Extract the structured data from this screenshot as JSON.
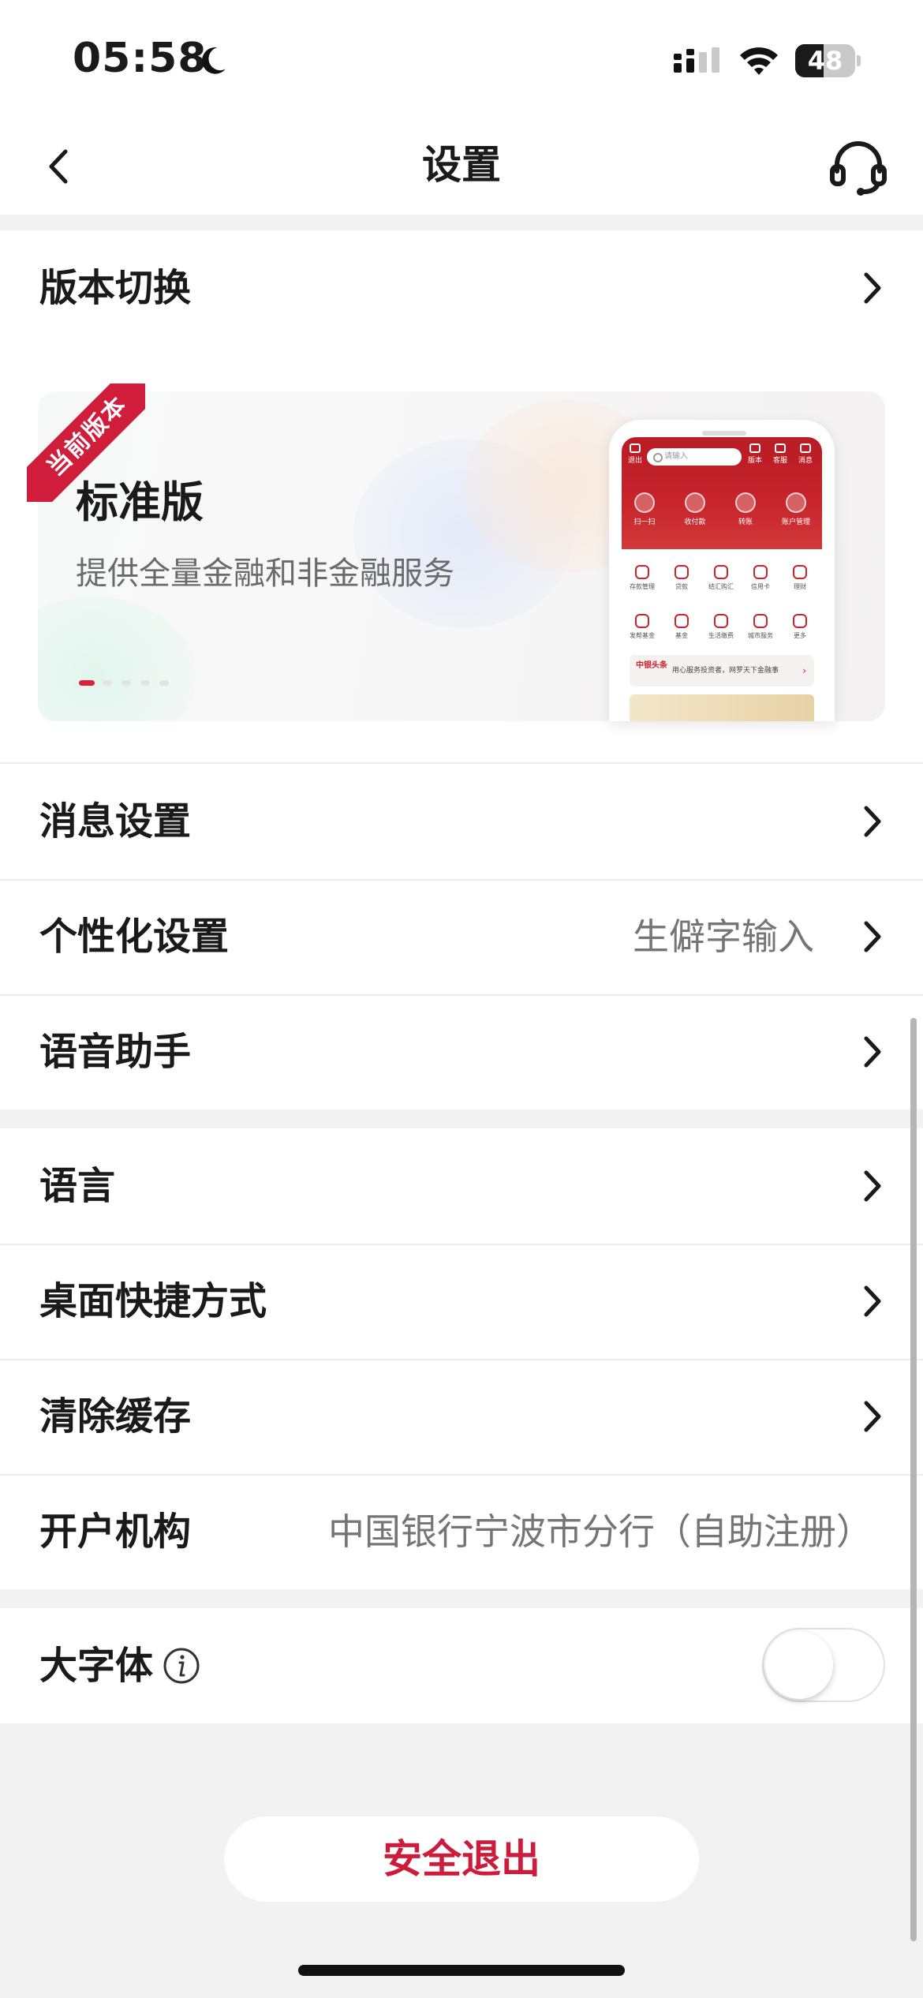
{
  "status_bar": {
    "time": "05:58",
    "battery_level": "48",
    "battery_percent": 48
  },
  "nav": {
    "title": "设置",
    "back_icon": "chevron-left-icon",
    "support_icon": "headset-icon"
  },
  "version_section": {
    "label": "版本切换",
    "ribbon": "当前版本",
    "card": {
      "title": "标准版",
      "description": "提供全量金融和非金融服务",
      "carousel_pages": 5,
      "carousel_active": 1
    },
    "mockup": {
      "top_left": "退出",
      "search_placeholder": "请输入",
      "top_items": [
        "版本",
        "客服",
        "消息"
      ],
      "quick_actions": [
        "扫一扫",
        "收付款",
        "转账",
        "账户管理"
      ],
      "grid_row1": [
        "存款管理",
        "贷款",
        "结汇购汇",
        "信用卡",
        "理财"
      ],
      "grid_row2": [
        "发帮基金",
        "基金",
        "生活缴费",
        "城市服务",
        "更多"
      ],
      "banner_logo": "中银头条",
      "banner_text": "用心服务投资者，网罗天下金融事"
    }
  },
  "group1": [
    {
      "label": "消息设置",
      "value": ""
    },
    {
      "label": "个性化设置",
      "value": "生僻字输入"
    },
    {
      "label": "语音助手",
      "value": ""
    }
  ],
  "group2": [
    {
      "label": "语言",
      "value": ""
    },
    {
      "label": "桌面快捷方式",
      "value": ""
    },
    {
      "label": "清除缓存",
      "value": ""
    },
    {
      "label": "开户机构",
      "value": "中国银行宁波市分行（自助注册）"
    }
  ],
  "large_font": {
    "label": "大字体",
    "enabled": false
  },
  "logout": {
    "label": "安全退出"
  },
  "colors": {
    "accent": "#cf1b3b",
    "background": "#f2f2f2",
    "row_background": "#ffffff"
  }
}
